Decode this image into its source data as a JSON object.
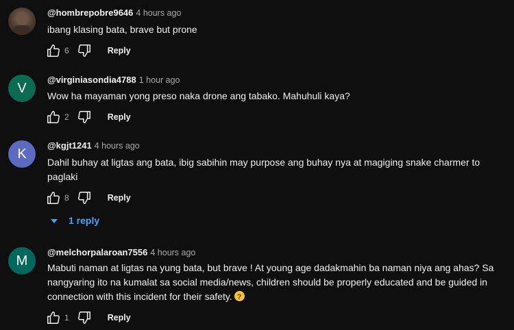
{
  "comments": [
    {
      "author": "@hombrepobre9646",
      "time": "4 hours ago",
      "text": "ibang klasing bata, brave but prone",
      "likes": "6",
      "reply_label": "Reply",
      "avatar_type": "photo"
    },
    {
      "author": "@virginiasondia4788",
      "time": "1 hour ago",
      "text": "Wow ha mayaman yong preso naka drone ang tabako. Mahuhuli kaya?",
      "likes": "2",
      "reply_label": "Reply",
      "avatar_letter": "V",
      "avatar_color": "#0b7a5a"
    },
    {
      "author": "@kgjt1241",
      "time": "4 hours ago",
      "text": "Dahil buhay at ligtas ang bata, ibig sabihin may purpose ang buhay nya at magiging snake charmer to paglaki",
      "likes": "8",
      "reply_label": "Reply",
      "avatar_letter": "K",
      "avatar_color": "#5c6bc0",
      "replies_label": "1 reply"
    },
    {
      "author": "@melchorpalaroan7556",
      "time": "4 hours ago",
      "text": "Mabuti naman at ligtas na yung bata, but brave ! At young age dadakmahin ba naman niya ang ahas? Sa nangyaring ito na kumalat sa social media/news, children should be properly educated and be guided in connection with this incident for their safety.",
      "likes": "1",
      "reply_label": "Reply",
      "avatar_letter": "M",
      "avatar_color": "#00695c",
      "emoji": "thinking-face-emoji"
    }
  ],
  "colors": {
    "background": "#0f0f0f",
    "text": "#f1f1f1",
    "muted": "#aaaaaa",
    "link": "#3ea6ff"
  }
}
